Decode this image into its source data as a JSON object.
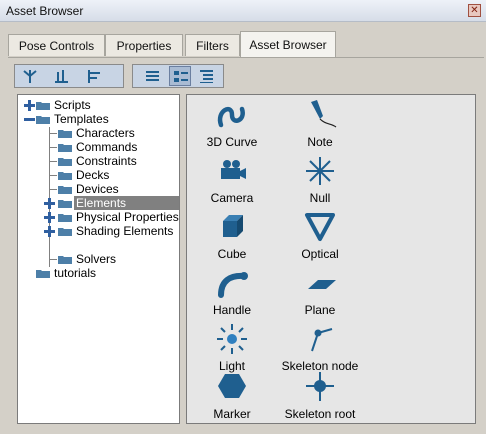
{
  "window": {
    "title": "Asset Browser",
    "close_glyph": "✕"
  },
  "tabs": [
    {
      "label": "Pose Controls"
    },
    {
      "label": "Properties"
    },
    {
      "label": "Filters"
    },
    {
      "label": "Asset Browser",
      "active": true
    }
  ],
  "toolbar": {
    "icons": [
      "tree-hierarchy-icon",
      "tree-bottom-align-icon",
      "tree-left-align-icon",
      "list-view-icon",
      "details-view-icon",
      "indented-list-icon"
    ],
    "active_index": 4
  },
  "tree": {
    "items": [
      {
        "label": "Scripts",
        "expander": "+"
      },
      {
        "label": "Templates",
        "expander": "−"
      },
      {
        "label": "Characters"
      },
      {
        "label": "Commands"
      },
      {
        "label": "Constraints"
      },
      {
        "label": "Decks"
      },
      {
        "label": "Devices"
      },
      {
        "label": "Elements",
        "expander": "+",
        "selected": true
      },
      {
        "label": "Physical Properties",
        "expander": "+"
      },
      {
        "label": "Shading Elements",
        "expander": "+"
      },
      {
        "label": "Solvers"
      },
      {
        "label": "tutorials"
      }
    ]
  },
  "assets": [
    {
      "label": "3D Curve",
      "icon": "curve-icon"
    },
    {
      "label": "Note",
      "icon": "note-pen-icon"
    },
    {
      "label": "Camera",
      "icon": "camera-icon"
    },
    {
      "label": "Null",
      "icon": "null-star-icon"
    },
    {
      "label": "Cube",
      "icon": "cube-icon"
    },
    {
      "label": "Optical",
      "icon": "optical-triangle-icon"
    },
    {
      "label": "Handle",
      "icon": "handle-icon"
    },
    {
      "label": "Plane",
      "icon": "plane-icon"
    },
    {
      "label": "Light",
      "icon": "light-icon"
    },
    {
      "label": "Skeleton node",
      "icon": "skeleton-node-icon"
    },
    {
      "label": "Marker",
      "icon": "marker-hexagon-icon"
    },
    {
      "label": "Skeleton root",
      "icon": "skeleton-root-icon"
    }
  ],
  "colors": {
    "icon_blue": "#1f5f8f",
    "folder": "#4d7fa8",
    "expander": "#2f5fa0",
    "selected": "#808080"
  }
}
